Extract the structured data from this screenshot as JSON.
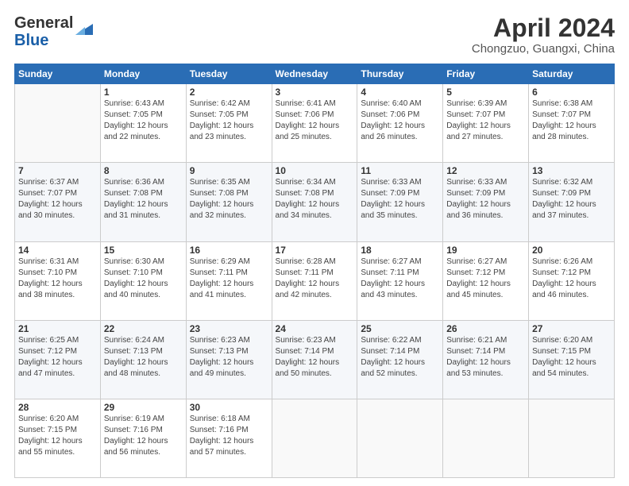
{
  "header": {
    "logo_general": "General",
    "logo_blue": "Blue",
    "month_title": "April 2024",
    "location": "Chongzuo, Guangxi, China"
  },
  "calendar": {
    "weekdays": [
      "Sunday",
      "Monday",
      "Tuesday",
      "Wednesday",
      "Thursday",
      "Friday",
      "Saturday"
    ],
    "weeks": [
      [
        {
          "day": "",
          "info": ""
        },
        {
          "day": "1",
          "info": "Sunrise: 6:43 AM\nSunset: 7:05 PM\nDaylight: 12 hours\nand 22 minutes."
        },
        {
          "day": "2",
          "info": "Sunrise: 6:42 AM\nSunset: 7:05 PM\nDaylight: 12 hours\nand 23 minutes."
        },
        {
          "day": "3",
          "info": "Sunrise: 6:41 AM\nSunset: 7:06 PM\nDaylight: 12 hours\nand 25 minutes."
        },
        {
          "day": "4",
          "info": "Sunrise: 6:40 AM\nSunset: 7:06 PM\nDaylight: 12 hours\nand 26 minutes."
        },
        {
          "day": "5",
          "info": "Sunrise: 6:39 AM\nSunset: 7:07 PM\nDaylight: 12 hours\nand 27 minutes."
        },
        {
          "day": "6",
          "info": "Sunrise: 6:38 AM\nSunset: 7:07 PM\nDaylight: 12 hours\nand 28 minutes."
        }
      ],
      [
        {
          "day": "7",
          "info": "Sunrise: 6:37 AM\nSunset: 7:07 PM\nDaylight: 12 hours\nand 30 minutes."
        },
        {
          "day": "8",
          "info": "Sunrise: 6:36 AM\nSunset: 7:08 PM\nDaylight: 12 hours\nand 31 minutes."
        },
        {
          "day": "9",
          "info": "Sunrise: 6:35 AM\nSunset: 7:08 PM\nDaylight: 12 hours\nand 32 minutes."
        },
        {
          "day": "10",
          "info": "Sunrise: 6:34 AM\nSunset: 7:08 PM\nDaylight: 12 hours\nand 34 minutes."
        },
        {
          "day": "11",
          "info": "Sunrise: 6:33 AM\nSunset: 7:09 PM\nDaylight: 12 hours\nand 35 minutes."
        },
        {
          "day": "12",
          "info": "Sunrise: 6:33 AM\nSunset: 7:09 PM\nDaylight: 12 hours\nand 36 minutes."
        },
        {
          "day": "13",
          "info": "Sunrise: 6:32 AM\nSunset: 7:09 PM\nDaylight: 12 hours\nand 37 minutes."
        }
      ],
      [
        {
          "day": "14",
          "info": "Sunrise: 6:31 AM\nSunset: 7:10 PM\nDaylight: 12 hours\nand 38 minutes."
        },
        {
          "day": "15",
          "info": "Sunrise: 6:30 AM\nSunset: 7:10 PM\nDaylight: 12 hours\nand 40 minutes."
        },
        {
          "day": "16",
          "info": "Sunrise: 6:29 AM\nSunset: 7:11 PM\nDaylight: 12 hours\nand 41 minutes."
        },
        {
          "day": "17",
          "info": "Sunrise: 6:28 AM\nSunset: 7:11 PM\nDaylight: 12 hours\nand 42 minutes."
        },
        {
          "day": "18",
          "info": "Sunrise: 6:27 AM\nSunset: 7:11 PM\nDaylight: 12 hours\nand 43 minutes."
        },
        {
          "day": "19",
          "info": "Sunrise: 6:27 AM\nSunset: 7:12 PM\nDaylight: 12 hours\nand 45 minutes."
        },
        {
          "day": "20",
          "info": "Sunrise: 6:26 AM\nSunset: 7:12 PM\nDaylight: 12 hours\nand 46 minutes."
        }
      ],
      [
        {
          "day": "21",
          "info": "Sunrise: 6:25 AM\nSunset: 7:12 PM\nDaylight: 12 hours\nand 47 minutes."
        },
        {
          "day": "22",
          "info": "Sunrise: 6:24 AM\nSunset: 7:13 PM\nDaylight: 12 hours\nand 48 minutes."
        },
        {
          "day": "23",
          "info": "Sunrise: 6:23 AM\nSunset: 7:13 PM\nDaylight: 12 hours\nand 49 minutes."
        },
        {
          "day": "24",
          "info": "Sunrise: 6:23 AM\nSunset: 7:14 PM\nDaylight: 12 hours\nand 50 minutes."
        },
        {
          "day": "25",
          "info": "Sunrise: 6:22 AM\nSunset: 7:14 PM\nDaylight: 12 hours\nand 52 minutes."
        },
        {
          "day": "26",
          "info": "Sunrise: 6:21 AM\nSunset: 7:14 PM\nDaylight: 12 hours\nand 53 minutes."
        },
        {
          "day": "27",
          "info": "Sunrise: 6:20 AM\nSunset: 7:15 PM\nDaylight: 12 hours\nand 54 minutes."
        }
      ],
      [
        {
          "day": "28",
          "info": "Sunrise: 6:20 AM\nSunset: 7:15 PM\nDaylight: 12 hours\nand 55 minutes."
        },
        {
          "day": "29",
          "info": "Sunrise: 6:19 AM\nSunset: 7:16 PM\nDaylight: 12 hours\nand 56 minutes."
        },
        {
          "day": "30",
          "info": "Sunrise: 6:18 AM\nSunset: 7:16 PM\nDaylight: 12 hours\nand 57 minutes."
        },
        {
          "day": "",
          "info": ""
        },
        {
          "day": "",
          "info": ""
        },
        {
          "day": "",
          "info": ""
        },
        {
          "day": "",
          "info": ""
        }
      ]
    ]
  }
}
